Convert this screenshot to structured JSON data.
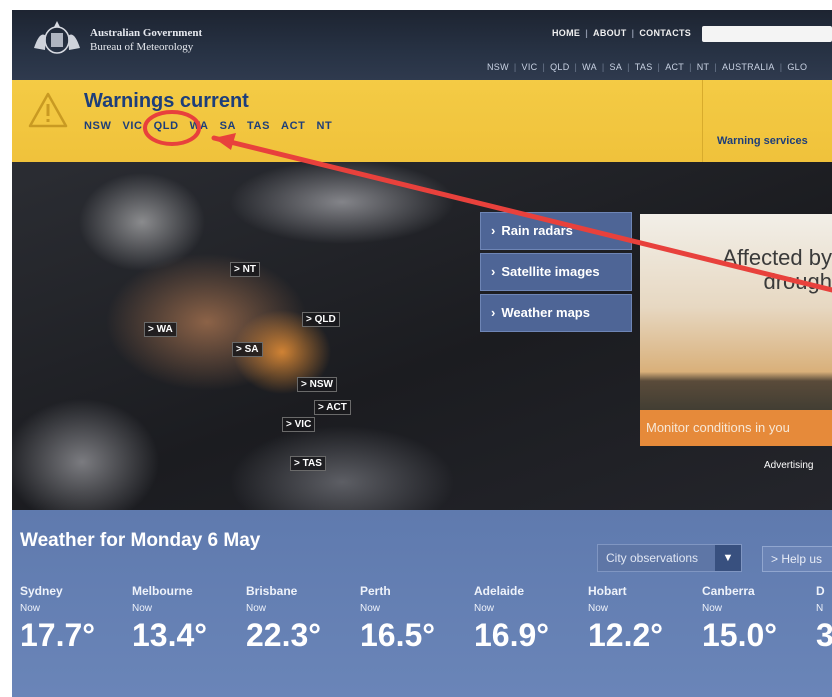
{
  "header": {
    "gov_line1": "Australian Government",
    "gov_line2": "Bureau of Meteorology",
    "top_links": [
      "HOME",
      "ABOUT",
      "CONTACTS"
    ],
    "state_nav": [
      "NSW",
      "VIC",
      "QLD",
      "WA",
      "SA",
      "TAS",
      "ACT",
      "NT",
      "AUSTRALIA",
      "GLO"
    ]
  },
  "warnings": {
    "title": "Warnings current",
    "states": [
      "NSW",
      "VIC",
      "QLD",
      "WA",
      "SA",
      "TAS",
      "ACT",
      "NT"
    ],
    "services_link": "Warning services"
  },
  "map_labels": [
    "> NT",
    "> WA",
    "> QLD",
    "> SA",
    "> NSW",
    "> ACT",
    "> VIC",
    "> TAS"
  ],
  "menu": {
    "items": [
      "Rain radars",
      "Satellite images",
      "Weather maps"
    ]
  },
  "ad": {
    "title": "Affected by drough",
    "strip": "Monitor conditions in you",
    "advertising_label": "Advertising"
  },
  "weather": {
    "title": "Weather for Monday 6 May",
    "city_select": "City observations",
    "help_button": "> Help us",
    "cities": [
      {
        "name": "Sydney",
        "label": "Now",
        "temp": "17.7°"
      },
      {
        "name": "Melbourne",
        "label": "Now",
        "temp": "13.4°"
      },
      {
        "name": "Brisbane",
        "label": "Now",
        "temp": "22.3°"
      },
      {
        "name": "Perth",
        "label": "Now",
        "temp": "16.5°"
      },
      {
        "name": "Adelaide",
        "label": "Now",
        "temp": "16.9°"
      },
      {
        "name": "Hobart",
        "label": "Now",
        "temp": "12.2°"
      },
      {
        "name": "Canberra",
        "label": "Now",
        "temp": "15.0°"
      },
      {
        "name": "D",
        "label": "N",
        "temp": "3"
      }
    ]
  },
  "colors": {
    "header_bg": "#273244",
    "warning_bg": "#f0c23b",
    "accent_blue": "#1d3e7a",
    "menu_bg": "#4e6596",
    "weather_bg": "#6a85b8",
    "annotation_red": "#e8413c"
  }
}
